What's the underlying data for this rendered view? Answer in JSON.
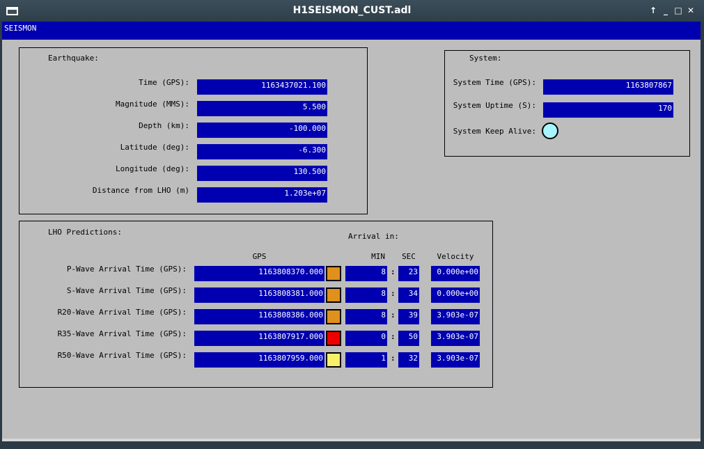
{
  "window": {
    "title": "H1SEISMON_CUST.adl",
    "buttons": [
      "↑",
      "_",
      "□",
      "✕"
    ]
  },
  "menubar": {
    "label": "SEISMON"
  },
  "earthquake": {
    "heading": "Earthquake:",
    "rows": [
      {
        "label": "Time (GPS):",
        "value": "1163437021.100"
      },
      {
        "label": "Magnitude (MMS):",
        "value": "5.500"
      },
      {
        "label": "Depth (km):",
        "value": "-100.000"
      },
      {
        "label": "Latitude (deg):",
        "value": "-6.300"
      },
      {
        "label": "Longitude (deg):",
        "value": "130.500"
      },
      {
        "label": "Distance from LHO (m)",
        "value": "1.203e+07"
      }
    ]
  },
  "system": {
    "heading": "System:",
    "time_label": "System Time (GPS):",
    "time_value": "1163807867",
    "uptime_label": "System Uptime (S):",
    "uptime_value": "170",
    "keepalive_label": "System Keep Alive:",
    "keepalive_color": "#a6f5ff"
  },
  "predictions": {
    "heading": "LHO Predictions:",
    "arrival_heading": "Arrival in:",
    "col_gps": "GPS",
    "col_min": "MIN",
    "col_sec": "SEC",
    "col_velocity": "Velocity",
    "colon": ":",
    "rows": [
      {
        "label": "P-Wave Arrival Time (GPS):",
        "gps": "1163808370.000",
        "status_color": "#e0901c",
        "min": "8",
        "sec": "23",
        "velocity": "0.000e+00"
      },
      {
        "label": "S-Wave Arrival Time (GPS):",
        "gps": "1163808381.000",
        "status_color": "#e0901c",
        "min": "8",
        "sec": "34",
        "velocity": "0.000e+00"
      },
      {
        "label": "R20-Wave Arrival Time (GPS):",
        "gps": "1163808386.000",
        "status_color": "#e0901c",
        "min": "8",
        "sec": "39",
        "velocity": "3.903e-07"
      },
      {
        "label": "R35-Wave Arrival Time (GPS):",
        "gps": "1163807917.000",
        "status_color": "#ee0000",
        "min": "0",
        "sec": "50",
        "velocity": "3.903e-07"
      },
      {
        "label": "R50-Wave Arrival Time (GPS):",
        "gps": "1163807959.000",
        "status_color": "#f8ef6a",
        "min": "1",
        "sec": "32",
        "velocity": "3.903e-07"
      }
    ]
  }
}
